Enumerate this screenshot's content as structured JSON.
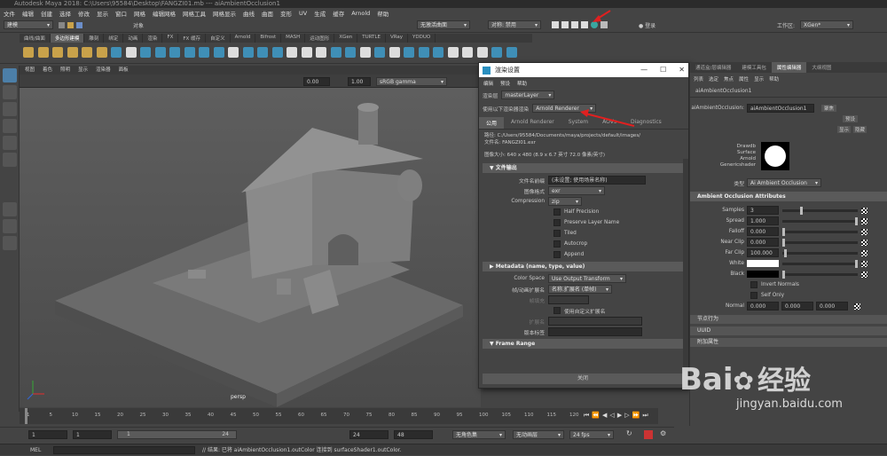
{
  "app": {
    "title": "Autodesk Maya 2018: C:\\Users\\95584\\Desktop\\FANGZI01.mb --- aiAmbientOcclusion1",
    "menus": [
      "文件",
      "编辑",
      "创建",
      "选择",
      "修改",
      "显示",
      "窗口",
      "网格",
      "编辑网格",
      "网格工具",
      "网格显示",
      "曲线",
      "曲面",
      "变形",
      "UV",
      "生成",
      "缓存",
      "Arnold",
      "帮助"
    ],
    "workspace_label": "工作区:",
    "workspace_value": "XGen*",
    "mode": "建模",
    "object_label": "对象",
    "no_live_surface": "无激活曲面",
    "symmetry_label": "对称: 禁用",
    "login": "登录"
  },
  "shelf": {
    "tabs": [
      "曲线/曲面",
      "多边形建模",
      "雕刻",
      "绑定",
      "动画",
      "渲染",
      "FX",
      "FX 缓存",
      "自定义",
      "Arnold",
      "Bifrost",
      "MASH",
      "运动图形",
      "XGen",
      "TURTLE",
      "VRay",
      "YDDUO"
    ],
    "active_tab": "多边形建模"
  },
  "viewport": {
    "menus": [
      "视图",
      "着色",
      "照明",
      "显示",
      "渲染器",
      "面板"
    ],
    "field_a": "0.00",
    "field_b": "1.00",
    "color_space": "sRGB gamma",
    "camera_label": "persp"
  },
  "timeline": {
    "ticks": [
      "1",
      "5",
      "10",
      "15",
      "20",
      "25",
      "30",
      "35",
      "40",
      "45",
      "50",
      "55",
      "60",
      "65",
      "70",
      "75",
      "80",
      "85",
      "90",
      "95",
      "100",
      "105",
      "110",
      "115",
      "120"
    ],
    "current_frame": "1"
  },
  "range": {
    "start": "1",
    "start2": "1",
    "slider_start": "1",
    "slider_end": "24",
    "end": "24",
    "end2": "48",
    "char_set": "无角色集",
    "anim_layer": "无动画层",
    "fps": "24 fps"
  },
  "command": {
    "lang": "MEL",
    "result": "// 结果: 已将 aiAmbientOcclusion1.outColor 连接到 surfaceShader1.outColor."
  },
  "render_dialog": {
    "title": "渲染设置",
    "menus": [
      "编辑",
      "预设",
      "帮助"
    ],
    "layer_label": "渲染层",
    "layer_value": "masterLayer",
    "renderer_label": "使用以下渲染器渲染",
    "renderer_value": "Arnold Renderer",
    "tabs": [
      "公用",
      "Arnold Renderer",
      "System",
      "AOVs",
      "Diagnostics"
    ],
    "active_tab": "公用",
    "path_label": "路径: C:/Users/95584/Documents/maya/projects/default/images/",
    "file_label": "文件名: FANGZI01.exr",
    "image_size": "图像大小: 640 x 480 (8.9 x 6.7 英寸 72.0 像素/英寸)",
    "section_file_output": "文件输出",
    "file_prefix_label": "文件名前缀",
    "file_prefix_value": "(未设置; 使用场景名称)",
    "image_format_label": "图像格式",
    "image_format_value": "exr",
    "compression_label": "Compression",
    "compression_value": "zip",
    "options": [
      "Half Precision",
      "Preserve Layer Name",
      "Tiled",
      "Autocrop",
      "Append"
    ],
    "section_metadata": "Metadata (name, type, value)",
    "color_space_label": "Color Space",
    "color_space_value": "Use Output Transform",
    "frame_ext_label": "帧/动画扩展名",
    "frame_ext_value": "名称.扩展名 (单帧)",
    "frame_padding_label": "帧填充",
    "custom_ext_label": "使用自定义扩展名",
    "extension_label": "扩展名",
    "version_label": "版本标签",
    "section_frame_range": "Frame Range",
    "close": "关闭"
  },
  "attr_editor": {
    "tabs": [
      "通道盒/层编辑器",
      "建模工具包",
      "属性编辑器",
      "大纲视图"
    ],
    "active_tab": "属性编辑器",
    "menus": [
      "列表",
      "选定",
      "焦点",
      "属性",
      "显示",
      "帮助"
    ],
    "node_tab": "aiAmbientOcclusion1",
    "node_label": "aiAmbientOcclusion:",
    "node_value": "aiAmbientOcclusion1",
    "focus_btn": "聚焦",
    "preset_btn": "预设",
    "show_btn": "显示",
    "hide_btn": "隐藏",
    "swatch_lines": [
      "Drawdb",
      "Surface",
      "Arnold",
      "Genericshader"
    ],
    "type_label": "类型",
    "type_value": "Ai Ambient Occlusion",
    "section_ao": "Ambient Occlusion Attributes",
    "samples_label": "Samples",
    "samples": "3",
    "spread_label": "Spread",
    "spread": "1.000",
    "falloff_label": "Falloff",
    "falloff": "0.000",
    "near_clip_label": "Near Clip",
    "near_clip": "0.000",
    "far_clip_label": "Far Clip",
    "far_clip": "100.000",
    "white_label": "White",
    "black_label": "Black",
    "invert_normals": "Invert Normals",
    "self_only": "Self Only",
    "normal_label": "Normal",
    "normal": [
      "0.000",
      "0.000",
      "0.000"
    ],
    "collapsed": [
      "节点行为",
      "UUID",
      "附加属性"
    ]
  },
  "watermark": {
    "brand": "Bai",
    "brand2": "经验",
    "url": "jingyan.baidu.com"
  },
  "colors": {
    "accent": "#4c7fa8",
    "annotation": "#e02020"
  }
}
